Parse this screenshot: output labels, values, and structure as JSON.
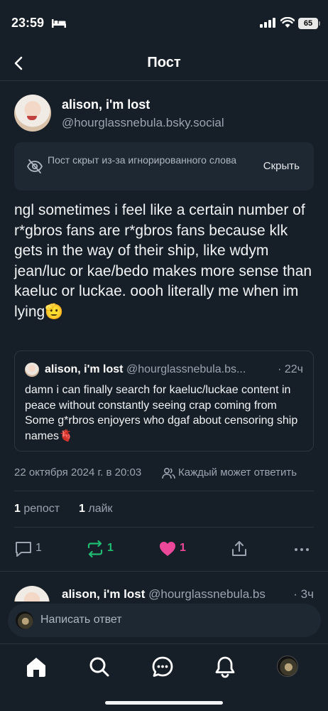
{
  "status_bar": {
    "time": "23:59",
    "battery": "65"
  },
  "header": {
    "title": "Пост"
  },
  "post": {
    "author_name": "alison, i'm lost",
    "author_handle": "@hourglassnebula.bsky.social",
    "hidden_notice": "Пост скрыт из-за игнорированного слова",
    "hide_label": "Скрыть",
    "text": "ngl sometimes i feel like a certain number of r*gbros fans are r*gbros fans because klk gets in the way of their ship, like wdym jean/luc or kae/bedo makes more sense than kaeluc or luckae. oooh literally me when im lying🫡",
    "quote": {
      "author_name": "alison, i'm lost",
      "author_handle": "@hourglassnebula.bs...",
      "time": "· 22ч",
      "text": "damn i can finally search for kaeluc/luckae content in peace without constantly seeing crap coming from Some g*rbros enjoyers who dgaf about censoring ship names🫀"
    },
    "date": "22 октября 2024 г. в 20:03",
    "reply_permission": "Каждый может ответить",
    "stats": {
      "reposts_count": "1",
      "reposts_label": "репост",
      "likes_count": "1",
      "likes_label": "лайк"
    },
    "actions": {
      "replies": "1",
      "reposts": "1",
      "likes": "1"
    }
  },
  "next_post": {
    "author_name": "alison, i'm lost",
    "author_handle": "@hourglassnebula.bs",
    "time": "· 3ч"
  },
  "reply_bar": {
    "placeholder": "Написать ответ"
  },
  "colors": {
    "background": "#161e27",
    "repost_active": "#20bc72",
    "like_active": "#ec4899",
    "muted": "#9aa5b1"
  },
  "tabs": [
    {
      "icon": "home-icon"
    },
    {
      "icon": "search-icon"
    },
    {
      "icon": "chat-icon"
    },
    {
      "icon": "bell-icon"
    },
    {
      "icon": "profile-avatar"
    }
  ]
}
